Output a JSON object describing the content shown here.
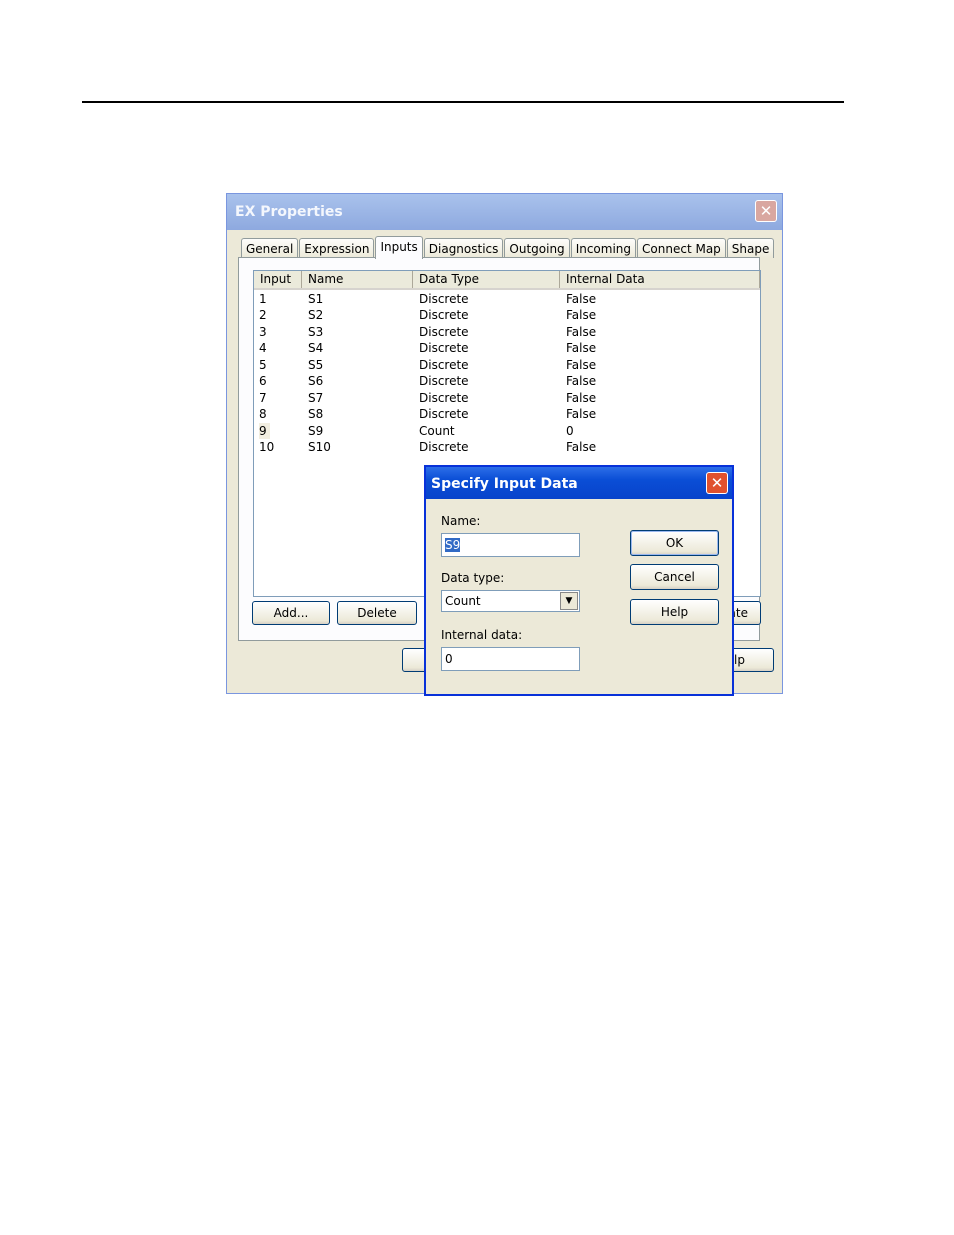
{
  "window": {
    "title": "EX Properties",
    "close_glyph": "✕",
    "tabs": [
      "General",
      "Expression",
      "Inputs",
      "Diagnostics",
      "Outgoing",
      "Incoming",
      "Connect Map",
      "Shape"
    ],
    "active_tab": "Inputs",
    "list": {
      "columns": [
        "Input",
        "Name",
        "Data Type",
        "Internal Data"
      ],
      "rows": [
        [
          "1",
          "S1",
          "Discrete",
          "False"
        ],
        [
          "2",
          "S2",
          "Discrete",
          "False"
        ],
        [
          "3",
          "S3",
          "Discrete",
          "False"
        ],
        [
          "4",
          "S4",
          "Discrete",
          "False"
        ],
        [
          "5",
          "S5",
          "Discrete",
          "False"
        ],
        [
          "6",
          "S6",
          "Discrete",
          "False"
        ],
        [
          "7",
          "S7",
          "Discrete",
          "False"
        ],
        [
          "8",
          "S8",
          "Discrete",
          "False"
        ],
        [
          "9",
          "S9",
          "Count",
          "0"
        ],
        [
          "10",
          "S10",
          "Discrete",
          "False"
        ]
      ]
    },
    "buttons": {
      "add": "Add...",
      "delete": "Delete",
      "partial_right": "ate",
      "bottom_partial": "lp"
    }
  },
  "dialog": {
    "title": "Specify Input Data",
    "close_glyph": "✕",
    "name_label": "Name:",
    "name_value": "S9",
    "data_type_label": "Data type:",
    "data_type_value": "Count",
    "dropdown_icon": "▼",
    "internal_data_label": "Internal data:",
    "internal_data_value": "0",
    "ok": "OK",
    "cancel": "Cancel",
    "help": "Help"
  }
}
